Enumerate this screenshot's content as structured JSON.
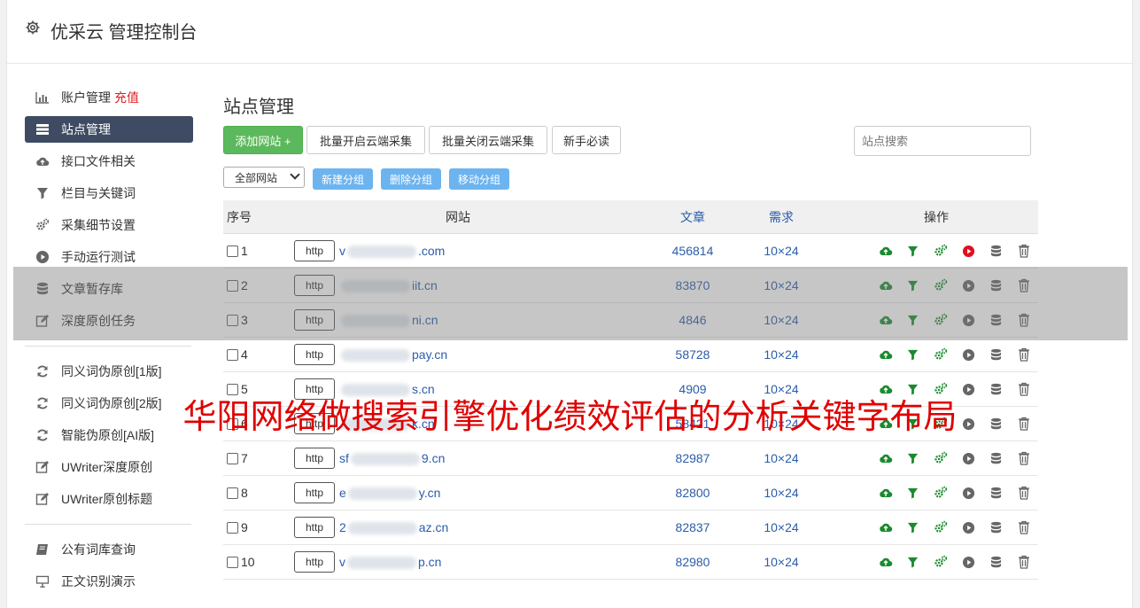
{
  "header": {
    "title": "优采云 管理控制台",
    "icon": "gear-icon"
  },
  "sidebar": {
    "items": [
      {
        "label": "账户管理",
        "badge": "充值",
        "icon": "bar-chart-icon",
        "active": false
      },
      {
        "label": "站点管理",
        "icon": "server-icon",
        "active": true
      },
      {
        "label": "接口文件相关",
        "icon": "cloud-upload-icon",
        "active": false
      },
      {
        "label": "栏目与关键词",
        "icon": "filter-icon",
        "active": false
      },
      {
        "label": "采集细节设置",
        "icon": "cogs-icon",
        "active": false
      },
      {
        "label": "手动运行测试",
        "icon": "play-circle-icon",
        "active": false
      },
      {
        "label": "文章暂存库",
        "icon": "database-icon",
        "active": false
      },
      {
        "label": "深度原创任务",
        "icon": "edit-icon",
        "active": false
      }
    ],
    "items2": [
      {
        "label": "同义词伪原创[1版]",
        "icon": "refresh-icon"
      },
      {
        "label": "同义词伪原创[2版]",
        "icon": "refresh-icon"
      },
      {
        "label": "智能伪原创[AI版]",
        "icon": "refresh-icon"
      },
      {
        "label": "UWriter深度原创",
        "icon": "edit-icon"
      },
      {
        "label": "UWriter原创标题",
        "icon": "edit-icon"
      }
    ],
    "items3": [
      {
        "label": "公有词库查询",
        "icon": "book-icon"
      },
      {
        "label": "正文识别演示",
        "icon": "desktop-icon"
      }
    ]
  },
  "main": {
    "title": "站点管理",
    "buttons": {
      "add": "添加网站 +",
      "batch_on": "批量开启云端采集",
      "batch_off": "批量关闭云端采集",
      "guide": "新手必读"
    },
    "search_placeholder": "站点搜索",
    "group_select": "全部网站",
    "group_buttons": {
      "new": "新建分组",
      "delete": "删除分组",
      "move": "移动分组"
    },
    "table": {
      "headers": {
        "no": "序号",
        "site": "网站",
        "articles": "文章",
        "demand": "需求",
        "ops": "操作"
      },
      "rows": [
        {
          "no": "1",
          "prefix": "v",
          "suffix": ".com",
          "articles": "456814",
          "demand": "10×24",
          "running": true
        },
        {
          "no": "2",
          "prefix": "",
          "suffix": "iit.cn",
          "articles": "83870",
          "demand": "10×24",
          "running": false
        },
        {
          "no": "3",
          "prefix": "",
          "suffix": "ni.cn",
          "articles": "4846",
          "demand": "10×24",
          "running": false
        },
        {
          "no": "4",
          "prefix": "",
          "suffix": "pay.cn",
          "articles": "58728",
          "demand": "10×24",
          "running": false
        },
        {
          "no": "5",
          "prefix": "",
          "suffix": "s.cn",
          "articles": "4909",
          "demand": "10×24",
          "running": false
        },
        {
          "no": "6",
          "prefix": "",
          "suffix": "k.cn",
          "articles": "58421",
          "demand": "10×24",
          "running": false
        },
        {
          "no": "7",
          "prefix": "sf",
          "suffix": "9.cn",
          "articles": "82987",
          "demand": "10×24",
          "running": false
        },
        {
          "no": "8",
          "prefix": "e",
          "suffix": "y.cn",
          "articles": "82800",
          "demand": "10×24",
          "running": false
        },
        {
          "no": "9",
          "prefix": "2",
          "suffix": "az.cn",
          "articles": "82837",
          "demand": "10×24",
          "running": false
        },
        {
          "no": "10",
          "prefix": "v",
          "suffix": "p.cn",
          "articles": "82980",
          "demand": "10×24",
          "running": false
        }
      ],
      "http_label": "http"
    }
  },
  "overlay_text": "华阳网络做搜索引擎优化绩效评估的分析关键字布局",
  "colors": {
    "primary_green": "#5cb85c",
    "nav_active": "#3e4b63",
    "link_blue": "#2a5caa",
    "red": "#e00000"
  }
}
